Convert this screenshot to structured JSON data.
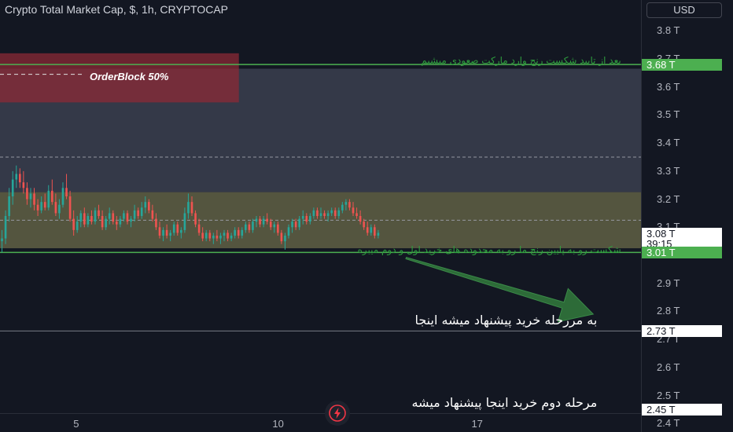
{
  "header": {
    "title": "Crypto Total Market Cap, $, 1h, CRYPTOCAP",
    "currency_button": "USD"
  },
  "colors": {
    "background": "#131722",
    "up_candle": "#26a69a",
    "down_candle": "#ef5350",
    "green_line": "#4caf50",
    "range_zone": "#6b6b4a",
    "orderblock_zone": "#8b2a35",
    "upper_zone": "#3b3f4f",
    "arrow_fill": "#2d6b38"
  },
  "icons": {
    "logo": "tradingview-logo-icon"
  },
  "chart_data": {
    "type": "candlestick",
    "title": "Crypto Total Market Cap, $, 1h, CRYPTOCAP",
    "units": "T USD",
    "y_axis": {
      "ticks": [
        "3.8 T",
        "3.7 T",
        "3.6 T",
        "3.5 T",
        "3.4 T",
        "3.3 T",
        "3.2 T",
        "3.1 T",
        "3.0 T",
        "2.9 T",
        "2.8 T",
        "2.7 T",
        "2.6 T",
        "2.5 T",
        "2.4 T"
      ],
      "tick_values": [
        3.8,
        3.7,
        3.6,
        3.5,
        3.4,
        3.3,
        3.2,
        3.1,
        3.0,
        2.9,
        2.8,
        2.7,
        2.6,
        2.5,
        2.4
      ],
      "range": [
        2.37,
        3.91
      ]
    },
    "x_axis": {
      "ticks": [
        "5",
        "10",
        "17"
      ],
      "tick_positions_day": [
        5,
        10,
        15
      ],
      "range_day": [
        3.0,
        19.1
      ]
    },
    "price_tags": [
      {
        "label": "3.68 T",
        "value": 3.68,
        "style": "green"
      },
      {
        "label": "3.08 T",
        "sub": "39:15",
        "value": 3.08,
        "style": "last"
      },
      {
        "label": "3.01 T",
        "value": 3.01,
        "style": "green"
      },
      {
        "label": "2.73 T",
        "value": 2.73,
        "style": "white"
      },
      {
        "label": "2.45 T",
        "value": 2.45,
        "style": "white"
      }
    ],
    "levels": [
      {
        "value": 3.68,
        "style": "green-solid"
      },
      {
        "value": 3.35,
        "style": "gray-dashed"
      },
      {
        "value": 3.125,
        "style": "gray-dashed"
      },
      {
        "value": 3.01,
        "style": "green-solid"
      },
      {
        "value": 2.73,
        "style": "gray-solid"
      }
    ],
    "zones": [
      {
        "kind": "orderblock",
        "from_day": 3.0,
        "to_day": 9.0,
        "top": 3.72,
        "bottom": 3.545
      },
      {
        "kind": "upper-range",
        "from_day": 3.0,
        "to_day": 19.1,
        "top": 3.665,
        "bottom": 3.225
      },
      {
        "kind": "consolidation",
        "from_day": 3.0,
        "to_day": 19.1,
        "top": 3.225,
        "bottom": 3.025
      }
    ],
    "orderblock_label": "OrderBlock  50%",
    "orderblock_level": 3.645,
    "arrow": {
      "from_day": 13.2,
      "from_value": 2.99,
      "to_day": 17.9,
      "to_value": 2.79
    },
    "annotations": [
      {
        "text": "بعد از تایید شکست رنج وارد مارکت صعودی میشیم",
        "style": "green",
        "day": 18.6,
        "value": 3.692
      },
      {
        "text": "شکست رو به پایین رنج ما رو به محدوده های خرید اول و دوم میبره",
        "style": "green",
        "day": 18.6,
        "value": 3.019
      },
      {
        "text": "به مررحله خرید پیشنهاد میشه اینجا",
        "style": "white",
        "day": 18.0,
        "value": 2.768
      },
      {
        "text": "مرحله دوم خرید اینجا پیشنهاد میشه",
        "style": "white",
        "day": 18.0,
        "value": 2.475
      }
    ],
    "candles": [
      {
        "day": 3.05,
        "o": 3.05,
        "h": 3.09,
        "l": 3.01,
        "c": 3.06
      },
      {
        "day": 3.14,
        "o": 3.06,
        "h": 3.16,
        "l": 3.04,
        "c": 3.14
      },
      {
        "day": 3.23,
        "o": 3.14,
        "h": 3.24,
        "l": 3.12,
        "c": 3.21
      },
      {
        "day": 3.32,
        "o": 3.21,
        "h": 3.3,
        "l": 3.18,
        "c": 3.27
      },
      {
        "day": 3.41,
        "o": 3.27,
        "h": 3.32,
        "l": 3.24,
        "c": 3.29
      },
      {
        "day": 3.5,
        "o": 3.29,
        "h": 3.31,
        "l": 3.24,
        "c": 3.26
      },
      {
        "day": 3.59,
        "o": 3.26,
        "h": 3.3,
        "l": 3.22,
        "c": 3.24
      },
      {
        "day": 3.68,
        "o": 3.24,
        "h": 3.26,
        "l": 3.18,
        "c": 3.2
      },
      {
        "day": 3.77,
        "o": 3.2,
        "h": 3.24,
        "l": 3.17,
        "c": 3.22
      },
      {
        "day": 3.86,
        "o": 3.22,
        "h": 3.24,
        "l": 3.16,
        "c": 3.18
      },
      {
        "day": 3.95,
        "o": 3.18,
        "h": 3.2,
        "l": 3.14,
        "c": 3.16
      },
      {
        "day": 4.04,
        "o": 3.16,
        "h": 3.21,
        "l": 3.15,
        "c": 3.19
      },
      {
        "day": 4.13,
        "o": 3.19,
        "h": 3.22,
        "l": 3.16,
        "c": 3.17
      },
      {
        "day": 4.22,
        "o": 3.17,
        "h": 3.25,
        "l": 3.16,
        "c": 3.23
      },
      {
        "day": 4.31,
        "o": 3.23,
        "h": 3.27,
        "l": 3.18,
        "c": 3.19
      },
      {
        "day": 4.4,
        "o": 3.19,
        "h": 3.22,
        "l": 3.14,
        "c": 3.15
      },
      {
        "day": 4.49,
        "o": 3.15,
        "h": 3.2,
        "l": 3.13,
        "c": 3.18
      },
      {
        "day": 4.58,
        "o": 3.18,
        "h": 3.26,
        "l": 3.17,
        "c": 3.24
      },
      {
        "day": 4.67,
        "o": 3.24,
        "h": 3.29,
        "l": 3.2,
        "c": 3.21
      },
      {
        "day": 4.76,
        "o": 3.21,
        "h": 3.23,
        "l": 3.12,
        "c": 3.13
      },
      {
        "day": 4.85,
        "o": 3.13,
        "h": 3.16,
        "l": 3.07,
        "c": 3.09
      },
      {
        "day": 4.94,
        "o": 3.09,
        "h": 3.14,
        "l": 3.08,
        "c": 3.12
      },
      {
        "day": 5.03,
        "o": 3.12,
        "h": 3.16,
        "l": 3.1,
        "c": 3.15
      },
      {
        "day": 5.12,
        "o": 3.15,
        "h": 3.17,
        "l": 3.1,
        "c": 3.11
      },
      {
        "day": 5.21,
        "o": 3.11,
        "h": 3.15,
        "l": 3.1,
        "c": 3.14
      },
      {
        "day": 5.3,
        "o": 3.14,
        "h": 3.16,
        "l": 3.11,
        "c": 3.12
      },
      {
        "day": 5.39,
        "o": 3.12,
        "h": 3.17,
        "l": 3.11,
        "c": 3.16
      },
      {
        "day": 5.48,
        "o": 3.16,
        "h": 3.18,
        "l": 3.13,
        "c": 3.14
      },
      {
        "day": 5.57,
        "o": 3.14,
        "h": 3.16,
        "l": 3.09,
        "c": 3.1
      },
      {
        "day": 5.66,
        "o": 3.1,
        "h": 3.14,
        "l": 3.09,
        "c": 3.13
      },
      {
        "day": 5.75,
        "o": 3.13,
        "h": 3.17,
        "l": 3.11,
        "c": 3.15
      },
      {
        "day": 5.84,
        "o": 3.15,
        "h": 3.16,
        "l": 3.11,
        "c": 3.12
      },
      {
        "day": 5.93,
        "o": 3.12,
        "h": 3.14,
        "l": 3.09,
        "c": 3.11
      },
      {
        "day": 6.02,
        "o": 3.11,
        "h": 3.14,
        "l": 3.1,
        "c": 3.13
      },
      {
        "day": 6.11,
        "o": 3.13,
        "h": 3.16,
        "l": 3.12,
        "c": 3.15
      },
      {
        "day": 6.2,
        "o": 3.15,
        "h": 3.16,
        "l": 3.11,
        "c": 3.12
      },
      {
        "day": 6.29,
        "o": 3.12,
        "h": 3.14,
        "l": 3.1,
        "c": 3.13
      },
      {
        "day": 6.38,
        "o": 3.13,
        "h": 3.18,
        "l": 3.12,
        "c": 3.16
      },
      {
        "day": 6.47,
        "o": 3.16,
        "h": 3.17,
        "l": 3.13,
        "c": 3.14
      },
      {
        "day": 6.56,
        "o": 3.14,
        "h": 3.19,
        "l": 3.13,
        "c": 3.17
      },
      {
        "day": 6.65,
        "o": 3.17,
        "h": 3.21,
        "l": 3.15,
        "c": 3.19
      },
      {
        "day": 6.74,
        "o": 3.19,
        "h": 3.2,
        "l": 3.15,
        "c": 3.16
      },
      {
        "day": 6.83,
        "o": 3.16,
        "h": 3.18,
        "l": 3.12,
        "c": 3.13
      },
      {
        "day": 6.92,
        "o": 3.13,
        "h": 3.15,
        "l": 3.09,
        "c": 3.1
      },
      {
        "day": 7.01,
        "o": 3.1,
        "h": 3.12,
        "l": 3.06,
        "c": 3.07
      },
      {
        "day": 7.1,
        "o": 3.07,
        "h": 3.1,
        "l": 3.05,
        "c": 3.09
      },
      {
        "day": 7.19,
        "o": 3.09,
        "h": 3.11,
        "l": 3.06,
        "c": 3.07
      },
      {
        "day": 7.28,
        "o": 3.07,
        "h": 3.09,
        "l": 3.05,
        "c": 3.08
      },
      {
        "day": 7.37,
        "o": 3.08,
        "h": 3.12,
        "l": 3.07,
        "c": 3.11
      },
      {
        "day": 7.46,
        "o": 3.11,
        "h": 3.12,
        "l": 3.07,
        "c": 3.08
      },
      {
        "day": 7.55,
        "o": 3.08,
        "h": 3.1,
        "l": 3.06,
        "c": 3.09
      },
      {
        "day": 7.64,
        "o": 3.09,
        "h": 3.17,
        "l": 3.08,
        "c": 3.15
      },
      {
        "day": 7.73,
        "o": 3.15,
        "h": 3.22,
        "l": 3.13,
        "c": 3.19
      },
      {
        "day": 7.82,
        "o": 3.19,
        "h": 3.21,
        "l": 3.14,
        "c": 3.15
      },
      {
        "day": 7.91,
        "o": 3.15,
        "h": 3.16,
        "l": 3.1,
        "c": 3.11
      },
      {
        "day": 8.0,
        "o": 3.11,
        "h": 3.13,
        "l": 3.07,
        "c": 3.08
      },
      {
        "day": 8.09,
        "o": 3.08,
        "h": 3.1,
        "l": 3.05,
        "c": 3.06
      },
      {
        "day": 8.18,
        "o": 3.06,
        "h": 3.09,
        "l": 3.05,
        "c": 3.08
      },
      {
        "day": 8.27,
        "o": 3.08,
        "h": 3.09,
        "l": 3.05,
        "c": 3.06
      },
      {
        "day": 8.36,
        "o": 3.06,
        "h": 3.08,
        "l": 3.04,
        "c": 3.07
      },
      {
        "day": 8.45,
        "o": 3.07,
        "h": 3.09,
        "l": 3.05,
        "c": 3.06
      },
      {
        "day": 8.54,
        "o": 3.06,
        "h": 3.08,
        "l": 3.04,
        "c": 3.07
      },
      {
        "day": 8.63,
        "o": 3.07,
        "h": 3.09,
        "l": 3.05,
        "c": 3.08
      },
      {
        "day": 8.72,
        "o": 3.08,
        "h": 3.09,
        "l": 3.05,
        "c": 3.06
      },
      {
        "day": 8.81,
        "o": 3.06,
        "h": 3.08,
        "l": 3.05,
        "c": 3.07
      },
      {
        "day": 8.9,
        "o": 3.07,
        "h": 3.1,
        "l": 3.06,
        "c": 3.09
      },
      {
        "day": 8.99,
        "o": 3.09,
        "h": 3.1,
        "l": 3.06,
        "c": 3.07
      },
      {
        "day": 9.08,
        "o": 3.07,
        "h": 3.1,
        "l": 3.06,
        "c": 3.09
      },
      {
        "day": 9.17,
        "o": 3.09,
        "h": 3.12,
        "l": 3.08,
        "c": 3.11
      },
      {
        "day": 9.26,
        "o": 3.11,
        "h": 3.12,
        "l": 3.08,
        "c": 3.09
      },
      {
        "day": 9.35,
        "o": 3.09,
        "h": 3.13,
        "l": 3.08,
        "c": 3.12
      },
      {
        "day": 9.44,
        "o": 3.12,
        "h": 3.14,
        "l": 3.1,
        "c": 3.13
      },
      {
        "day": 9.53,
        "o": 3.13,
        "h": 3.14,
        "l": 3.1,
        "c": 3.11
      },
      {
        "day": 9.62,
        "o": 3.11,
        "h": 3.14,
        "l": 3.1,
        "c": 3.13
      },
      {
        "day": 9.71,
        "o": 3.13,
        "h": 3.15,
        "l": 3.11,
        "c": 3.12
      },
      {
        "day": 9.8,
        "o": 3.12,
        "h": 3.13,
        "l": 3.09,
        "c": 3.1
      },
      {
        "day": 9.89,
        "o": 3.1,
        "h": 3.12,
        "l": 3.08,
        "c": 3.11
      },
      {
        "day": 9.98,
        "o": 3.11,
        "h": 3.12,
        "l": 3.07,
        "c": 3.08
      },
      {
        "day": 10.07,
        "o": 3.08,
        "h": 3.09,
        "l": 3.04,
        "c": 3.05
      },
      {
        "day": 10.16,
        "o": 3.05,
        "h": 3.08,
        "l": 3.02,
        "c": 3.07
      },
      {
        "day": 10.25,
        "o": 3.07,
        "h": 3.11,
        "l": 3.06,
        "c": 3.1
      },
      {
        "day": 10.34,
        "o": 3.1,
        "h": 3.13,
        "l": 3.08,
        "c": 3.12
      },
      {
        "day": 10.43,
        "o": 3.12,
        "h": 3.13,
        "l": 3.09,
        "c": 3.1
      },
      {
        "day": 10.52,
        "o": 3.1,
        "h": 3.14,
        "l": 3.09,
        "c": 3.13
      },
      {
        "day": 10.61,
        "o": 3.13,
        "h": 3.16,
        "l": 3.11,
        "c": 3.14
      },
      {
        "day": 10.7,
        "o": 3.14,
        "h": 3.15,
        "l": 3.11,
        "c": 3.12
      },
      {
        "day": 10.79,
        "o": 3.12,
        "h": 3.15,
        "l": 3.11,
        "c": 3.14
      },
      {
        "day": 10.88,
        "o": 3.14,
        "h": 3.17,
        "l": 3.13,
        "c": 3.16
      },
      {
        "day": 10.97,
        "o": 3.16,
        "h": 3.17,
        "l": 3.13,
        "c": 3.14
      },
      {
        "day": 11.06,
        "o": 3.14,
        "h": 3.17,
        "l": 3.13,
        "c": 3.15
      },
      {
        "day": 11.15,
        "o": 3.15,
        "h": 3.16,
        "l": 3.13,
        "c": 3.14
      },
      {
        "day": 11.24,
        "o": 3.14,
        "h": 3.16,
        "l": 3.12,
        "c": 3.15
      },
      {
        "day": 11.33,
        "o": 3.15,
        "h": 3.17,
        "l": 3.14,
        "c": 3.16
      },
      {
        "day": 11.42,
        "o": 3.16,
        "h": 3.17,
        "l": 3.13,
        "c": 3.14
      },
      {
        "day": 11.51,
        "o": 3.14,
        "h": 3.17,
        "l": 3.13,
        "c": 3.16
      },
      {
        "day": 11.6,
        "o": 3.16,
        "h": 3.19,
        "l": 3.15,
        "c": 3.18
      },
      {
        "day": 11.69,
        "o": 3.18,
        "h": 3.2,
        "l": 3.16,
        "c": 3.19
      },
      {
        "day": 11.78,
        "o": 3.19,
        "h": 3.2,
        "l": 3.16,
        "c": 3.17
      },
      {
        "day": 11.87,
        "o": 3.17,
        "h": 3.19,
        "l": 3.14,
        "c": 3.15
      },
      {
        "day": 11.96,
        "o": 3.15,
        "h": 3.17,
        "l": 3.13,
        "c": 3.14
      },
      {
        "day": 12.05,
        "o": 3.14,
        "h": 3.16,
        "l": 3.11,
        "c": 3.12
      },
      {
        "day": 12.14,
        "o": 3.12,
        "h": 3.13,
        "l": 3.09,
        "c": 3.1
      },
      {
        "day": 12.23,
        "o": 3.1,
        "h": 3.12,
        "l": 3.07,
        "c": 3.08
      },
      {
        "day": 12.32,
        "o": 3.08,
        "h": 3.11,
        "l": 3.07,
        "c": 3.1
      },
      {
        "day": 12.41,
        "o": 3.1,
        "h": 3.11,
        "l": 3.06,
        "c": 3.07
      },
      {
        "day": 12.5,
        "o": 3.07,
        "h": 3.09,
        "l": 3.06,
        "c": 3.08
      }
    ]
  }
}
